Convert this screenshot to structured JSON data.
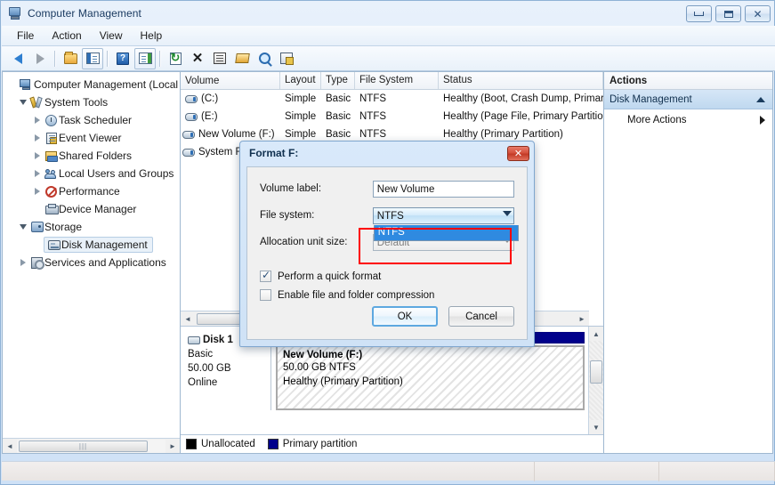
{
  "window": {
    "title": "Computer Management",
    "icon": "computer-management-icon",
    "buttons": {
      "minimize": "–",
      "maximize": "□",
      "close": "✕"
    }
  },
  "menubar": {
    "items": [
      "File",
      "Action",
      "View",
      "Help"
    ]
  },
  "toolbar": {
    "icons": [
      "back-arrow-icon",
      "forward-arrow-icon",
      "up-folder-icon",
      "show-tree-pane-icon",
      "help-icon",
      "show-action-pane-icon",
      "refresh-icon",
      "delete-icon",
      "properties-icon",
      "open-folder-icon",
      "search-icon",
      "disk-tools-icon"
    ]
  },
  "sidebar": {
    "items": [
      {
        "label": "Computer Management (Local",
        "icon": "computer-icon",
        "indent": 0,
        "expander": "none",
        "selected": false
      },
      {
        "label": "System Tools",
        "icon": "system-tools-icon",
        "indent": 1,
        "expander": "open",
        "selected": false
      },
      {
        "label": "Task Scheduler",
        "icon": "clock-icon",
        "indent": 2,
        "expander": "closed",
        "selected": false
      },
      {
        "label": "Event Viewer",
        "icon": "event-viewer-icon",
        "indent": 2,
        "expander": "closed",
        "selected": false
      },
      {
        "label": "Shared Folders",
        "icon": "shared-folders-icon",
        "indent": 2,
        "expander": "closed",
        "selected": false
      },
      {
        "label": "Local Users and Groups",
        "icon": "users-icon",
        "indent": 2,
        "expander": "closed",
        "selected": false
      },
      {
        "label": "Performance",
        "icon": "performance-icon",
        "indent": 2,
        "expander": "closed",
        "selected": false
      },
      {
        "label": "Device Manager",
        "icon": "device-manager-icon",
        "indent": 2,
        "expander": "none",
        "selected": false
      },
      {
        "label": "Storage",
        "icon": "storage-icon",
        "indent": 1,
        "expander": "open",
        "selected": false
      },
      {
        "label": "Disk Management",
        "icon": "disk-management-icon",
        "indent": 2,
        "expander": "none",
        "selected": true
      },
      {
        "label": "Services and Applications",
        "icon": "services-icon",
        "indent": 1,
        "expander": "closed",
        "selected": false
      }
    ]
  },
  "volume_list": {
    "columns": [
      "Volume",
      "Layout",
      "Type",
      "File System",
      "Status"
    ],
    "rows": [
      {
        "volume": "(C:)",
        "layout": "Simple",
        "type": "Basic",
        "filesystem": "NTFS",
        "status": "Healthy (Boot, Crash Dump, Primary"
      },
      {
        "volume": "(E:)",
        "layout": "Simple",
        "type": "Basic",
        "filesystem": "NTFS",
        "status": "Healthy (Page File, Primary Partition)"
      },
      {
        "volume": "New Volume (F:)",
        "layout": "Simple",
        "type": "Basic",
        "filesystem": "NTFS",
        "status": "Healthy (Primary Partition)"
      },
      {
        "volume": "System R",
        "layout": "",
        "type": "",
        "filesystem": "",
        "status": ", Primary Par"
      }
    ]
  },
  "graphical_view": {
    "disk": {
      "name": "Disk 1",
      "type": "Basic",
      "size": "50.00 GB",
      "state": "Online"
    },
    "partition": {
      "title": "New Volume  (F:)",
      "size_fs": "50.00 GB NTFS",
      "status": "Healthy (Primary Partition)",
      "cap_color": "#00008b"
    },
    "legend": [
      {
        "label": "Unallocated",
        "color": "#000000"
      },
      {
        "label": "Primary partition",
        "color": "#00008b"
      }
    ]
  },
  "actions": {
    "header": "Actions",
    "section": "Disk Management",
    "items": [
      "More Actions"
    ]
  },
  "dialog": {
    "title": "Format F:",
    "close_label": "✕",
    "fields": {
      "volume_label_label": "Volume label:",
      "volume_label_value": "New Volume",
      "file_system_label": "File system:",
      "file_system_value": "NTFS",
      "file_system_options": [
        "NTFS"
      ],
      "allocation_label": "Allocation unit size:",
      "allocation_value": "Default"
    },
    "checkboxes": [
      {
        "label": "Perform a quick format",
        "checked": true
      },
      {
        "label": "Enable file and folder compression",
        "checked": false
      }
    ],
    "buttons": {
      "ok": "OK",
      "cancel": "Cancel"
    },
    "highlight_color": "#ff0000"
  },
  "statusbar": {
    "text": ""
  }
}
